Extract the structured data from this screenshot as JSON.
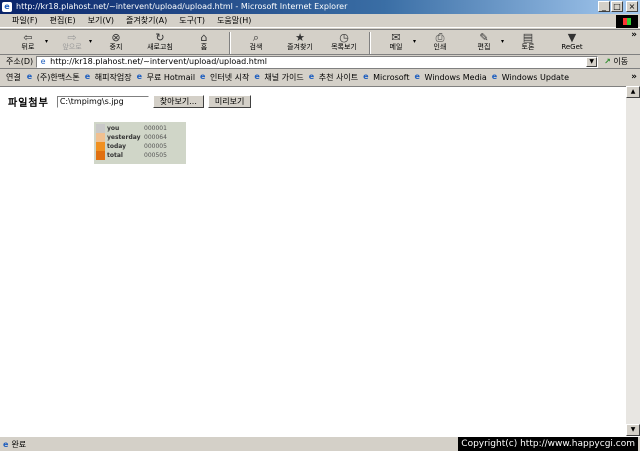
{
  "window": {
    "title": "http://kr18.plahost.net/~intervent/upload/upload.html - Microsoft Internet Explorer",
    "app_icon": "ie-icon",
    "minimize": "_",
    "maximize": "□",
    "close": "×"
  },
  "menubar": {
    "items": [
      "파일(F)",
      "편집(E)",
      "보기(V)",
      "즐겨찾기(A)",
      "도구(T)",
      "도움말(H)"
    ]
  },
  "toolbar": {
    "back": "뒤로",
    "forward": "앞으로",
    "stop": "중지",
    "refresh": "새로고침",
    "home": "홈",
    "search": "검색",
    "favorites": "즐겨찾기",
    "history": "목록보기",
    "mail": "메일",
    "print": "인쇄",
    "edit": "편집",
    "discuss": "토론",
    "reget": "ReGet",
    "more": "»"
  },
  "address": {
    "label": "주소(D)",
    "url": "http://kr18.plahost.net/~intervent/upload/upload.html",
    "go": "이동"
  },
  "links": {
    "label": "연결",
    "items": [
      "(주)한맥스톤",
      "해피작업장",
      "무료 Hotmail",
      "인터넷 시작",
      "채널 가이드",
      "추천 사이트",
      "Microsoft",
      "Windows Media",
      "Windows Update"
    ],
    "more": "»"
  },
  "form": {
    "label": "파일첨부",
    "file_value": "C:\\tmpimg\\s.jpg",
    "browse_button": "찾아보기...",
    "preview_button": "미리보기"
  },
  "counter": {
    "rows": [
      {
        "label": "you",
        "value": "000001",
        "color": "#c8c8c8"
      },
      {
        "label": "yesterday",
        "value": "000064",
        "color": "#f0c090"
      },
      {
        "label": "today",
        "value": "000005",
        "color": "#f09020"
      },
      {
        "label": "total",
        "value": "000505",
        "color": "#e07010"
      }
    ]
  },
  "status": {
    "text": "완료",
    "copyright": "Copyright(c) http://www.happycgi.com"
  }
}
